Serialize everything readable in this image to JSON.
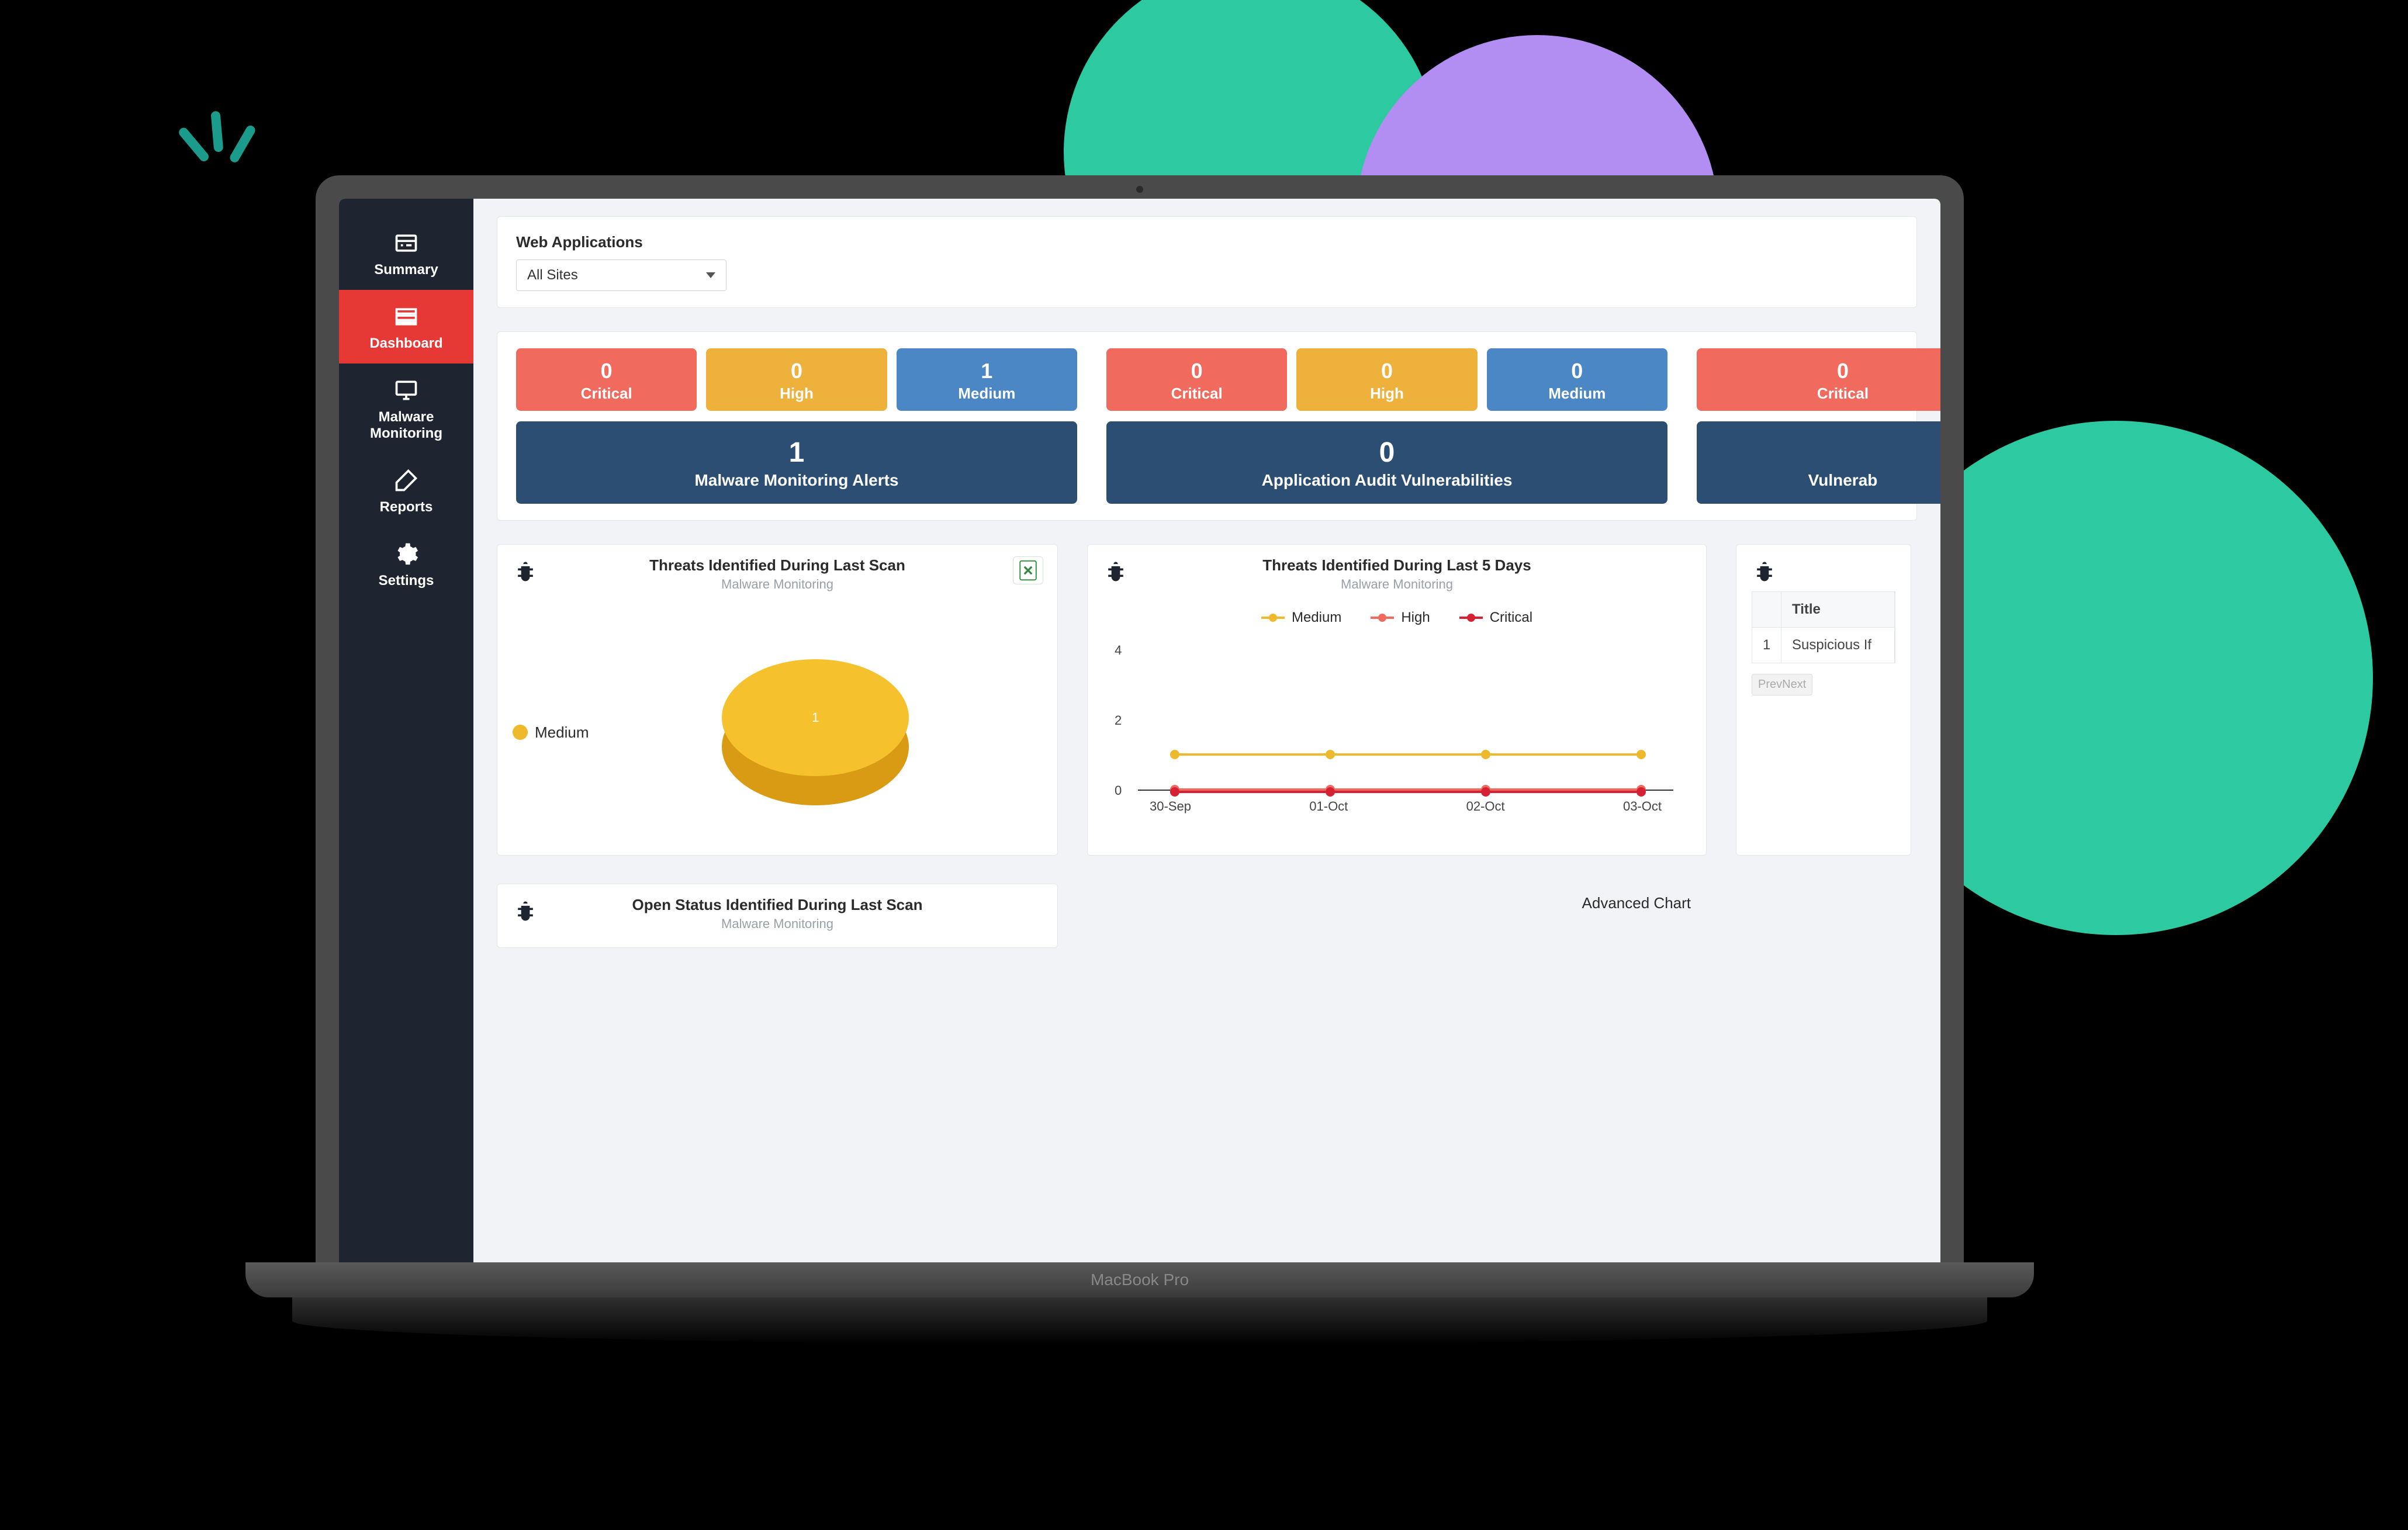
{
  "laptop": {
    "brand": "MacBook Pro"
  },
  "sidebar": {
    "items": [
      {
        "id": "summary",
        "label": "Summary",
        "active": false
      },
      {
        "id": "dashboard",
        "label": "Dashboard",
        "active": true
      },
      {
        "id": "malware",
        "label": "Malware Monitoring",
        "active": false
      },
      {
        "id": "reports",
        "label": "Reports",
        "active": false
      },
      {
        "id": "settings",
        "label": "Settings",
        "active": false
      }
    ]
  },
  "filter": {
    "label": "Web Applications",
    "selected": "All Sites"
  },
  "stat_groups": [
    {
      "tiles": [
        {
          "value": 0,
          "label": "Critical",
          "severity": "crit"
        },
        {
          "value": 0,
          "label": "High",
          "severity": "high"
        },
        {
          "value": 1,
          "label": "Medium",
          "severity": "med"
        }
      ],
      "summary": {
        "value": 1,
        "label": "Malware Monitoring Alerts"
      }
    },
    {
      "tiles": [
        {
          "value": 0,
          "label": "Critical",
          "severity": "crit"
        },
        {
          "value": 0,
          "label": "High",
          "severity": "high"
        },
        {
          "value": 0,
          "label": "Medium",
          "severity": "med"
        }
      ],
      "summary": {
        "value": 0,
        "label": "Application Audit Vulnerabilities"
      }
    },
    {
      "tiles": [
        {
          "value": 0,
          "label": "Critical",
          "severity": "crit"
        }
      ],
      "summary": {
        "value": null,
        "label": "Vulnerab"
      }
    }
  ],
  "cards": {
    "pie": {
      "title": "Threats Identified During Last Scan",
      "subtitle": "Malware Monitoring",
      "legend": "Medium",
      "center_value": "1"
    },
    "line": {
      "title": "Threats Identified During Last 5 Days",
      "subtitle": "Malware Monitoring",
      "legend": {
        "medium": "Medium",
        "high": "High",
        "critical": "Critical"
      },
      "y_ticks": [
        "4",
        "2",
        "0"
      ],
      "x_ticks": [
        "30-Sep",
        "01-Oct",
        "02-Oct",
        "03-Oct"
      ],
      "advanced_link": "Advanced Chart"
    },
    "table": {
      "header": {
        "col1": "",
        "col2": "Title"
      },
      "rows": [
        {
          "idx": "1",
          "title": "Suspicious If"
        }
      ],
      "pager": "PrevNext"
    },
    "openstatus": {
      "title": "Open Status Identified During Last Scan",
      "subtitle": "Malware Monitoring"
    }
  },
  "colors": {
    "critical": "#f06a5e",
    "high": "#eeb13c",
    "medium": "#4a87c4",
    "navy": "#2b4e72",
    "sidebar": "#1f2530",
    "active": "#e63936",
    "pie": "#f5c22e"
  },
  "chart_data": [
    {
      "type": "pie",
      "title": "Threats Identified During Last Scan",
      "series": [
        {
          "name": "Medium",
          "values": [
            1
          ],
          "color": "#f5c22e"
        }
      ],
      "total": 1
    },
    {
      "type": "line",
      "title": "Threats Identified During Last 5 Days",
      "categories": [
        "30-Sep",
        "01-Oct",
        "02-Oct",
        "03-Oct"
      ],
      "series": [
        {
          "name": "Medium",
          "values": [
            1,
            1,
            1,
            1
          ],
          "color": "#efb92e"
        },
        {
          "name": "High",
          "values": [
            0,
            0,
            0,
            0
          ],
          "color": "#f06a5e"
        },
        {
          "name": "Critical",
          "values": [
            0,
            0,
            0,
            0
          ],
          "color": "#d62034"
        }
      ],
      "xlabel": "",
      "ylabel": "",
      "ylim": [
        0,
        4
      ]
    }
  ]
}
